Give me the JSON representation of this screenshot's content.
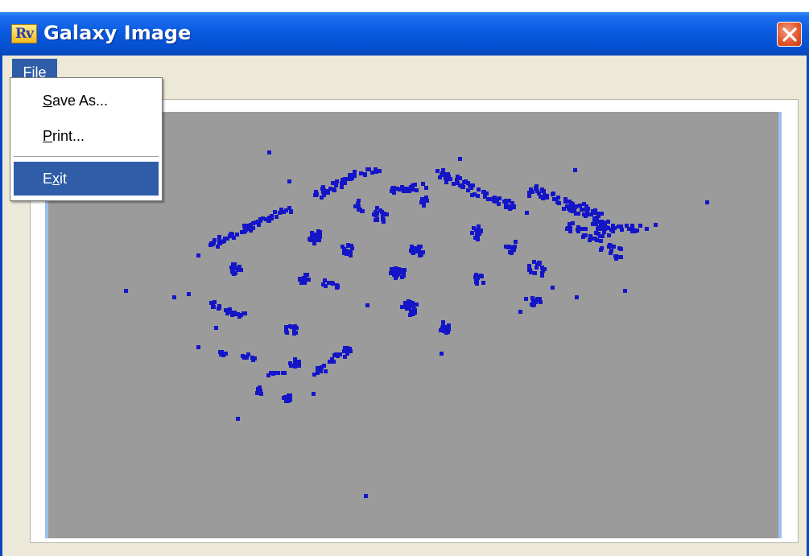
{
  "window": {
    "title": "Galaxy Image",
    "icon_text": "Rv"
  },
  "menubar": {
    "file": {
      "label_mnemonic": "F",
      "label_rest": "ile"
    }
  },
  "file_menu": {
    "save_as": {
      "mnemonic": "S",
      "rest": "ave As..."
    },
    "print": {
      "mnemonic": "P",
      "rest": "rint..."
    },
    "exit": {
      "prefix": "E",
      "mnemonic": "x",
      "rest": "it"
    }
  },
  "colors": {
    "titlebar": "#0a5be0",
    "panel_background": "#9b9b9b",
    "galaxy_points": "#1515c8",
    "menu_highlight": "#2f5da8",
    "close_button": "#e2542a"
  },
  "icons": {
    "app": "rv-app-icon",
    "close": "close-icon"
  }
}
